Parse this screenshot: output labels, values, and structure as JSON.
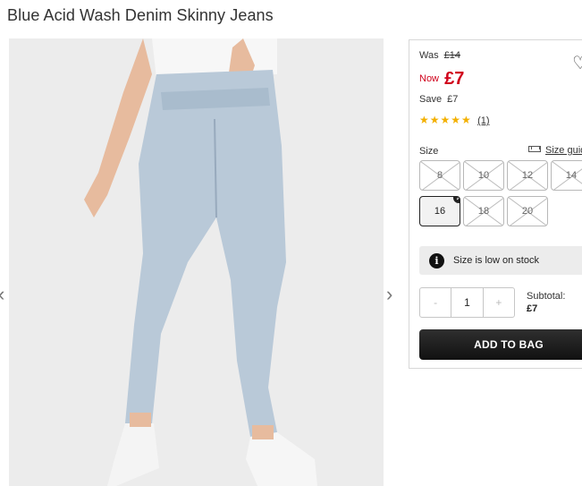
{
  "product": {
    "title": "Blue Acid Wash Denim Skinny Jeans"
  },
  "gallery": {
    "prev_icon": "‹",
    "next_icon": "›"
  },
  "pricing": {
    "was_label": "Was",
    "was_price": "£14",
    "now_label": "Now",
    "now_price": "£7",
    "save_label": "Save",
    "save_amount": "£7",
    "now_color": "#d0021b"
  },
  "rating": {
    "stars": "★★★★★",
    "value": 5,
    "count": "(1)"
  },
  "wishlist": {
    "icon": "heart-icon"
  },
  "size": {
    "label": "Size",
    "guide_label": "Size guide",
    "options": [
      {
        "label": "8",
        "available": false
      },
      {
        "label": "10",
        "available": false
      },
      {
        "label": "12",
        "available": false
      },
      {
        "label": "14",
        "available": false
      },
      {
        "label": "16",
        "available": true,
        "selected": true
      },
      {
        "label": "18",
        "available": false
      },
      {
        "label": "20",
        "available": false
      }
    ]
  },
  "stock": {
    "icon": "info-icon",
    "message": "Size is low on stock"
  },
  "quantity": {
    "minus": "-",
    "value": "1",
    "plus": "+"
  },
  "subtotal": {
    "label": "Subtotal:",
    "amount": "£7"
  },
  "cta": {
    "add_to_bag": "ADD TO BAG",
    "color": "#1a1a1a"
  }
}
